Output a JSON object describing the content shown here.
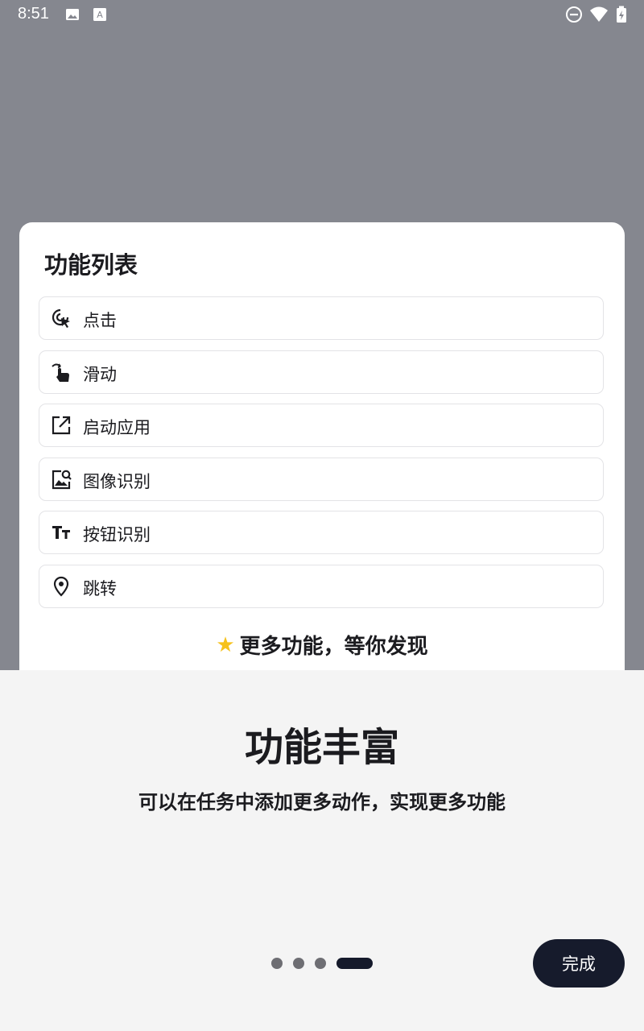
{
  "status_bar": {
    "time": "8:51",
    "left_icons": [
      "image-icon",
      "text-notification-icon"
    ],
    "right_icons": [
      "do-not-disturb-icon",
      "wifi-icon",
      "battery-charging-icon"
    ]
  },
  "card": {
    "title": "功能列表",
    "items": [
      {
        "label": "点击",
        "icon": "tap-icon"
      },
      {
        "label": "滑动",
        "icon": "swipe-icon"
      },
      {
        "label": "启动应用",
        "icon": "open-external-icon"
      },
      {
        "label": "图像识别",
        "icon": "image-search-icon"
      },
      {
        "label": "按钮识别",
        "icon": "text-size-icon"
      },
      {
        "label": "跳转",
        "icon": "location-pin-icon"
      }
    ],
    "more_icon": "star-icon",
    "more_text": "更多功能，等你发现"
  },
  "onboarding": {
    "title": "功能丰富",
    "subtitle": "可以在任务中添加更多动作，实现更多功能",
    "page_count": 4,
    "current_page": 4,
    "done_label": "完成"
  },
  "colors": {
    "overlay": "#85878f",
    "panel": "#f4f4f4",
    "accent_dark": "#161b2c"
  }
}
